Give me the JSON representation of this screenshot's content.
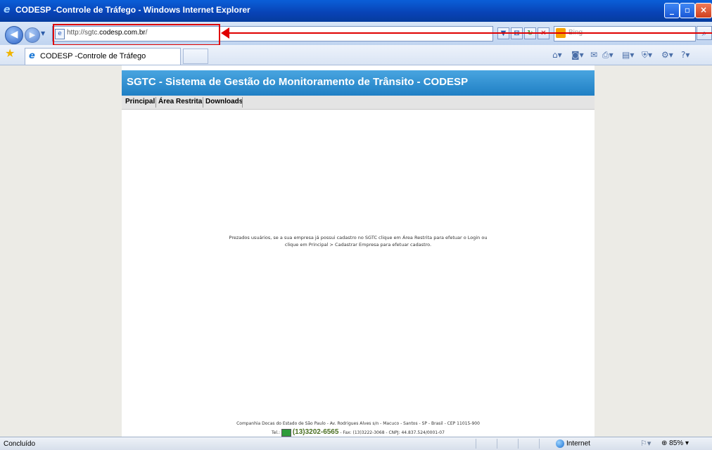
{
  "window": {
    "title": "CODESP -Controle de Tráfego - Windows Internet Explorer",
    "minimize_label": "_",
    "maximize_label": "▫",
    "close_label": "×"
  },
  "address": {
    "url_prefix": "http://sgtc.",
    "url_domain": "codesp.com.br",
    "url_suffix": "/"
  },
  "search": {
    "placeholder": "Bing"
  },
  "tab": {
    "label": "CODESP -Controle de Tráfego"
  },
  "page": {
    "banner": "SGTC - Sistema de Gestão do Monitoramento de Trânsito - CODESP",
    "menu": [
      "Principal",
      "Área Restrita",
      "Downloads"
    ],
    "message_line1": "Prezados usuários, se a sua empresa já possui cadastro no SGTC clique em Área Restrita para efetuar o Login ou",
    "message_line2": "clique em Principal > Cadastrar Empresa para efetuar cadastro.",
    "footer_line1": "Companhia Docas do Estado de São Paulo - Av. Rodrigues Alves s/n - Macuco - Santos - SP - Brasil - CEP 11015-900",
    "footer_tel_label": "Tel.:",
    "footer_phone": "(13)3202-6565",
    "footer_rest": "- Fax: (13)3222-3068 - CNPJ: 44.837.524/0001-07"
  },
  "status": {
    "text": "Concluído",
    "zone": "Internet",
    "zoom": "85%"
  },
  "colors": {
    "banner": "#2a8bd0",
    "annotation": "#e00000"
  }
}
